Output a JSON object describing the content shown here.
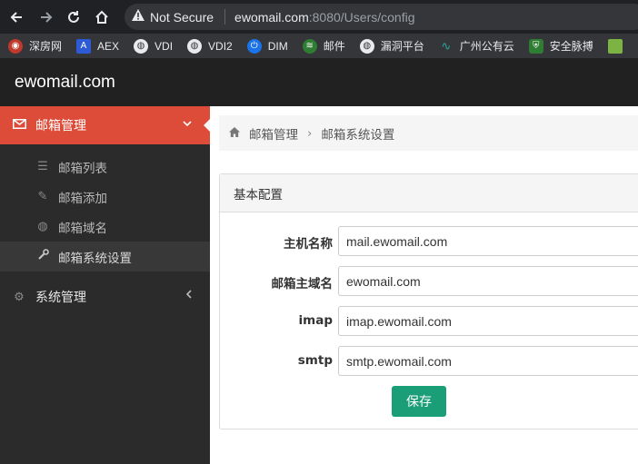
{
  "browser": {
    "status": "Not Secure",
    "url_host": "ewomail.com",
    "url_rest": ":8080/Users/config",
    "bookmarks": [
      {
        "label": "深房网",
        "icon": "globe-icon",
        "color": "#c0392b"
      },
      {
        "label": "AEX",
        "icon": "aex-icon",
        "color": "#2d5bd6"
      },
      {
        "label": "VDI",
        "icon": "globe-icon",
        "color": "#5f6368"
      },
      {
        "label": "VDI2",
        "icon": "globe-icon",
        "color": "#5f6368"
      },
      {
        "label": "DIM",
        "icon": "power-icon",
        "color": "#1a73e8"
      },
      {
        "label": "邮件",
        "icon": "mail-icon",
        "color": "#2e7d32"
      },
      {
        "label": "漏洞平台",
        "icon": "globe-icon",
        "color": "#5f6368"
      },
      {
        "label": "广州公有云",
        "icon": "wave-icon",
        "color": "#26a69a"
      },
      {
        "label": "安全脉搏",
        "icon": "shield-icon",
        "color": "#2e7d32"
      }
    ]
  },
  "app": {
    "logo": "ewomail.com"
  },
  "sidebar": {
    "mailbox_section": "邮箱管理",
    "items": [
      {
        "label": "邮箱列表",
        "icon": "list-icon"
      },
      {
        "label": "邮箱添加",
        "icon": "pencil-icon"
      },
      {
        "label": "邮箱域名",
        "icon": "globe-icon"
      },
      {
        "label": "邮箱系统设置",
        "icon": "wrench-icon"
      }
    ],
    "system_section": "系统管理"
  },
  "breadcrumb": {
    "parent": "邮箱管理",
    "current": "邮箱系统设置"
  },
  "panel": {
    "title": "基本配置",
    "fields": [
      {
        "label": "主机名称",
        "value": "mail.ewomail.com"
      },
      {
        "label": "邮箱主域名",
        "value": "ewomail.com"
      },
      {
        "label": "imap",
        "value": "imap.ewomail.com"
      },
      {
        "label": "smtp",
        "value": "smtp.ewomail.com"
      }
    ],
    "save_label": "保存"
  },
  "colors": {
    "active_menu": "#dd4b39",
    "save_button": "#1a9e77",
    "header_bg": "#212121",
    "sidebar_bg": "#2b2b2b"
  }
}
